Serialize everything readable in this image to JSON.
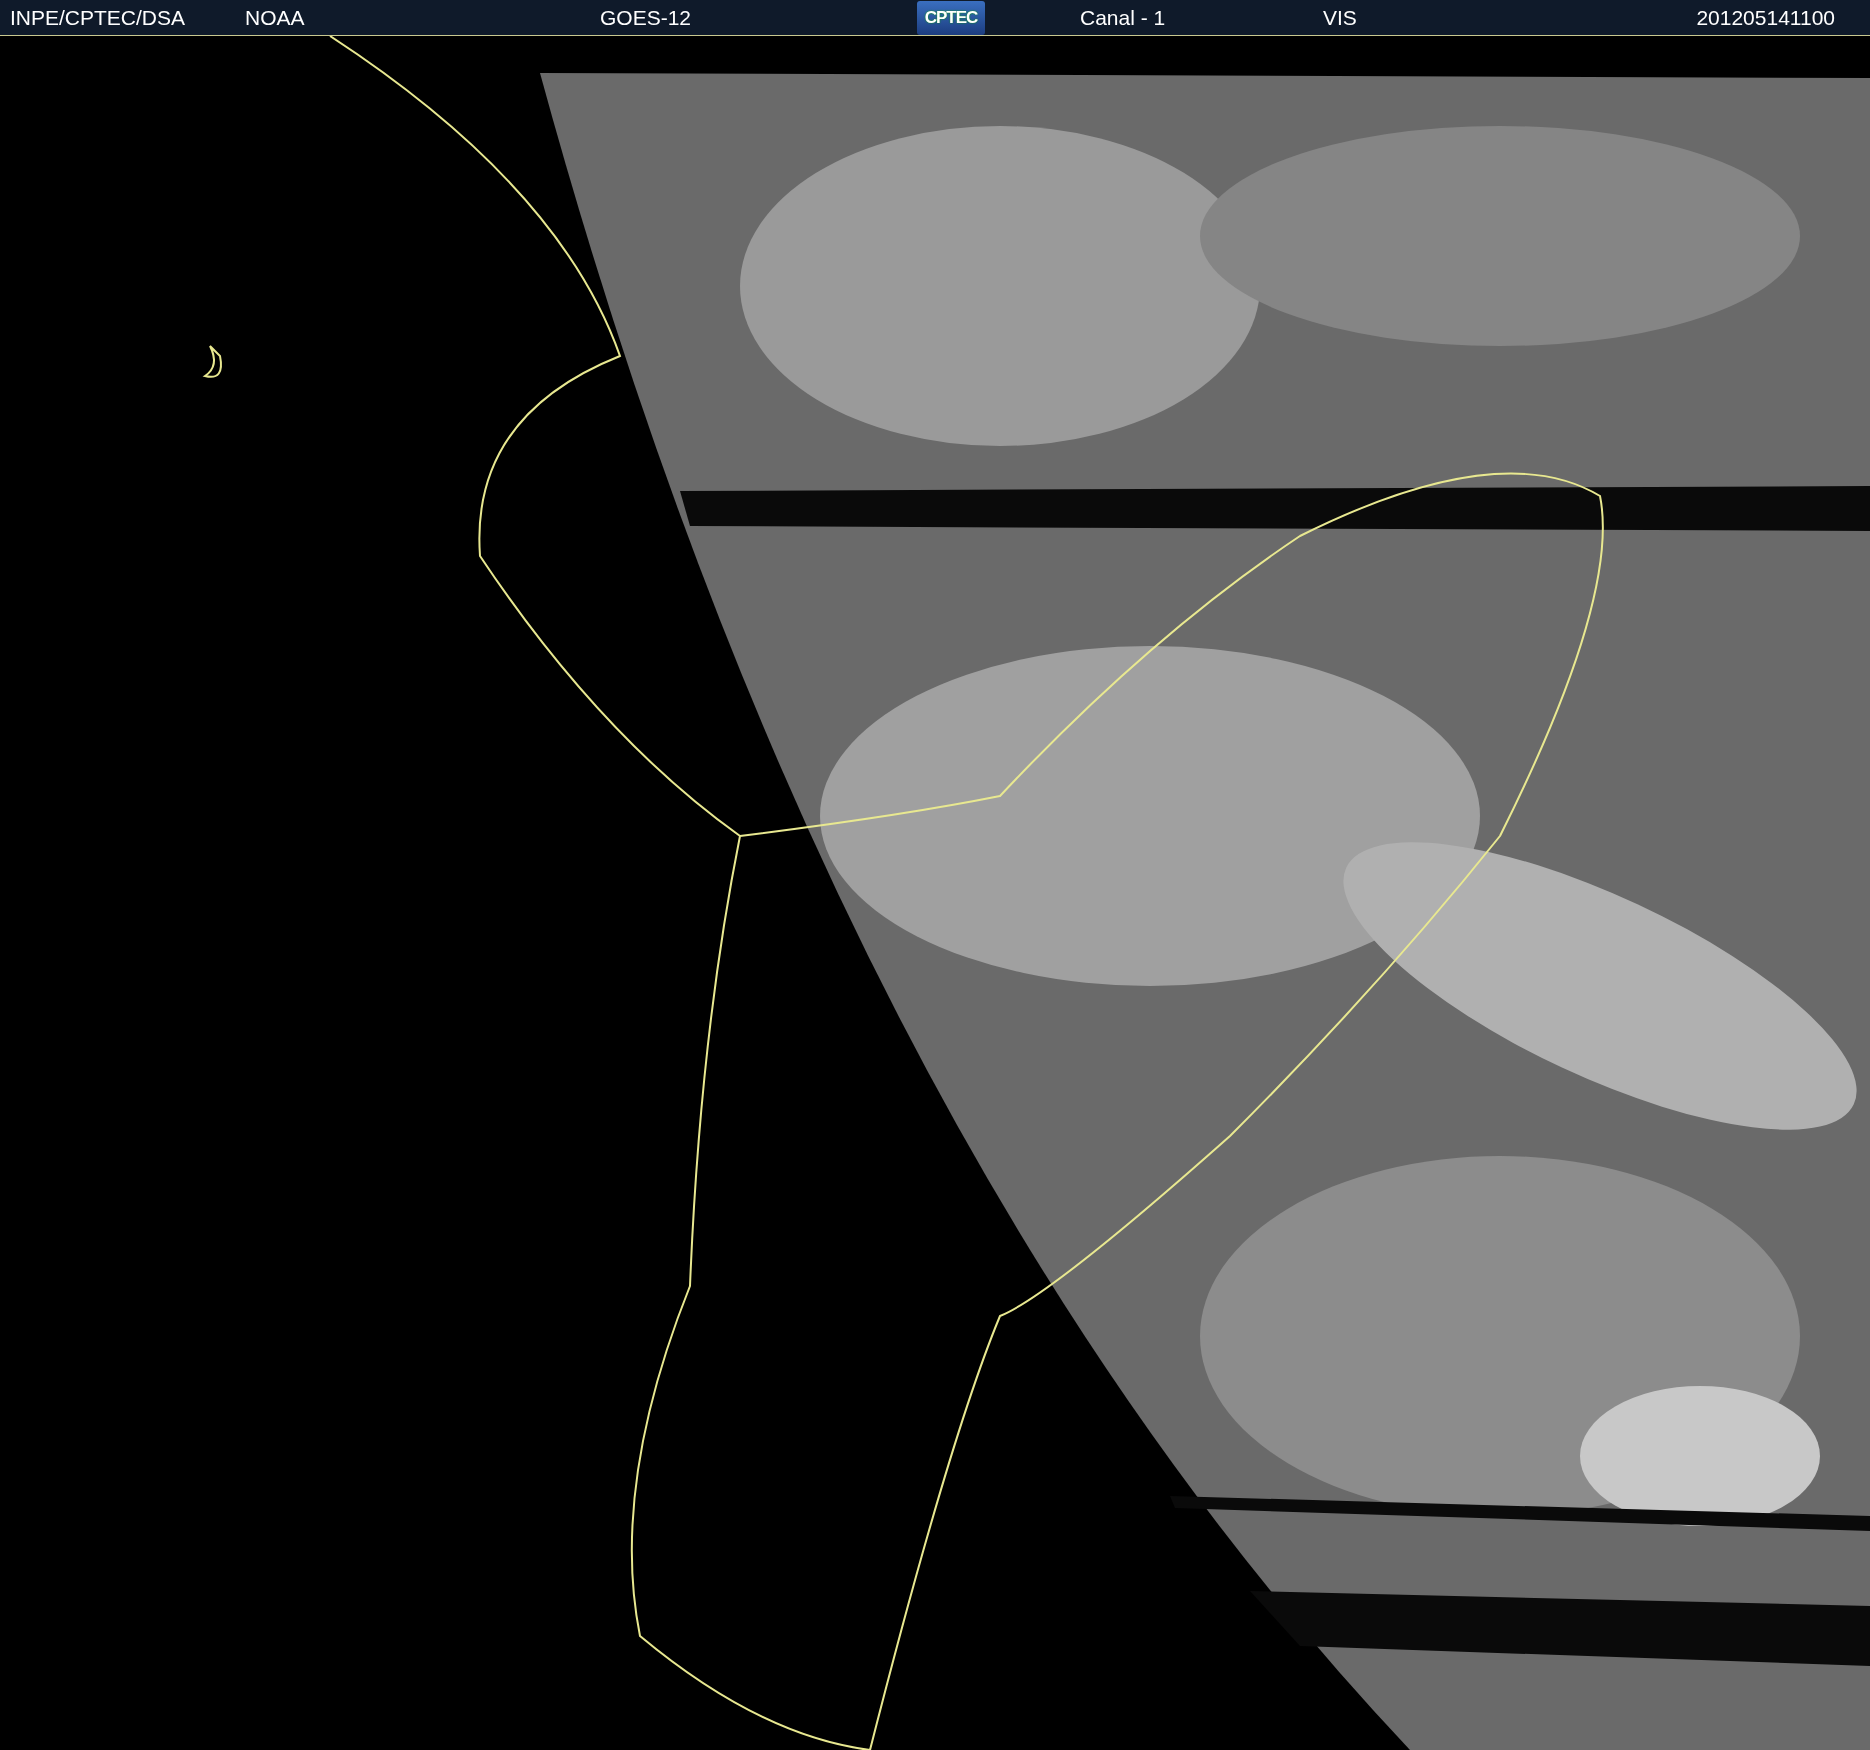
{
  "header": {
    "source": "INPE/CPTEC/DSA",
    "agency": "NOAA",
    "satellite": "GOES-12",
    "logo_text": "CPTEC",
    "channel": "Canal - 1",
    "band": "VIS",
    "timestamp": "201205141100"
  }
}
